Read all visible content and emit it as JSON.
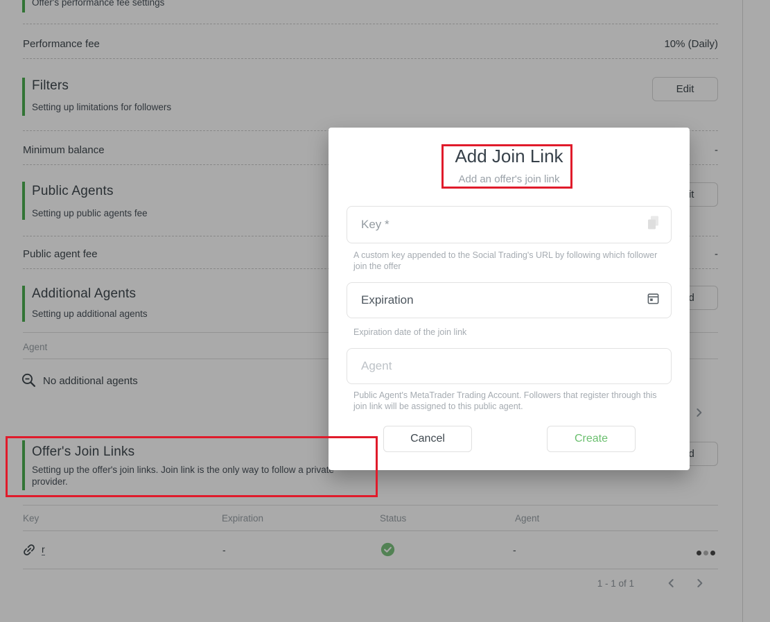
{
  "colors": {
    "accent_green": "#4caf50",
    "annotation_red": "#e01b2b",
    "create_green": "#6abf6e",
    "status_green": "#7cc47f"
  },
  "page": {
    "perf_section": {
      "subtitle": "Offer's performance fee settings"
    },
    "performance_fee": {
      "label": "Performance fee",
      "value": "10% (Daily)"
    },
    "filters": {
      "title": "Filters",
      "subtitle": "Setting up limitations for followers",
      "edit_label": "Edit"
    },
    "minimum_balance": {
      "label": "Minimum balance",
      "value": "-"
    },
    "public_agents": {
      "title": "Public Agents",
      "subtitle": "Setting up public agents fee",
      "edit_label": "Edit"
    },
    "public_agent_fee": {
      "label": "Public agent fee",
      "value": "-"
    },
    "additional_agents": {
      "title": "Additional Agents",
      "subtitle": "Setting up additional agents",
      "add_label": "Add",
      "table_header": "Agent",
      "empty_text": "No additional agents"
    },
    "join_links": {
      "title": "Offer's Join Links",
      "subtitle": "Setting up the offer's join links. Join link is the only way to follow a private provider.",
      "add_label": "Add",
      "headers": {
        "key": "Key",
        "expiration": "Expiration",
        "status": "Status",
        "agent": "Agent"
      },
      "row": {
        "key": "r",
        "expiration": "-",
        "agent": "-"
      },
      "pagination": "1 - 1 of 1"
    }
  },
  "modal": {
    "title": "Add Join Link",
    "subtitle": "Add an offer's join link",
    "key_field": {
      "placeholder": "Key *",
      "helper": "A custom key appended to the Social Trading's URL by following which follower join the offer"
    },
    "expiration_field": {
      "label": "Expiration",
      "helper": "Expiration date of the join link"
    },
    "agent_field": {
      "placeholder": "Agent",
      "helper": "Public Agent's MetaTrader Trading Account. Followers that register through this join link will be assigned to this public agent."
    },
    "cancel_label": "Cancel",
    "create_label": "Create"
  }
}
